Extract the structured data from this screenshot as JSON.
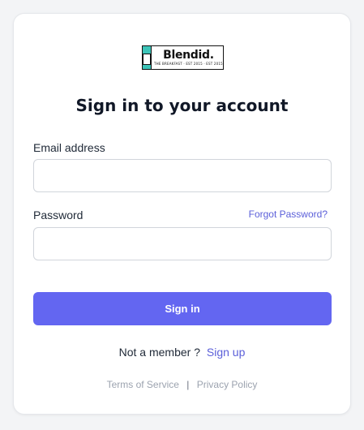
{
  "logo": {
    "name": "Blendid.",
    "tagline": "THE BREAKFAST · EST 2015 · EST 2015"
  },
  "form": {
    "title": "Sign in to your account",
    "email_label": "Email address",
    "email_value": "",
    "password_label": "Password",
    "password_value": "",
    "forgot_link": "Forgot Password?",
    "submit_label": "Sign in"
  },
  "signup": {
    "prompt": "Not a member ?",
    "link": "Sign up"
  },
  "footer": {
    "terms": "Terms of Service",
    "separator": "|",
    "privacy": "Privacy Policy"
  },
  "colors": {
    "accent": "#6366f1",
    "link": "#5b5fd9",
    "logo_teal": "#3cc4b8"
  }
}
